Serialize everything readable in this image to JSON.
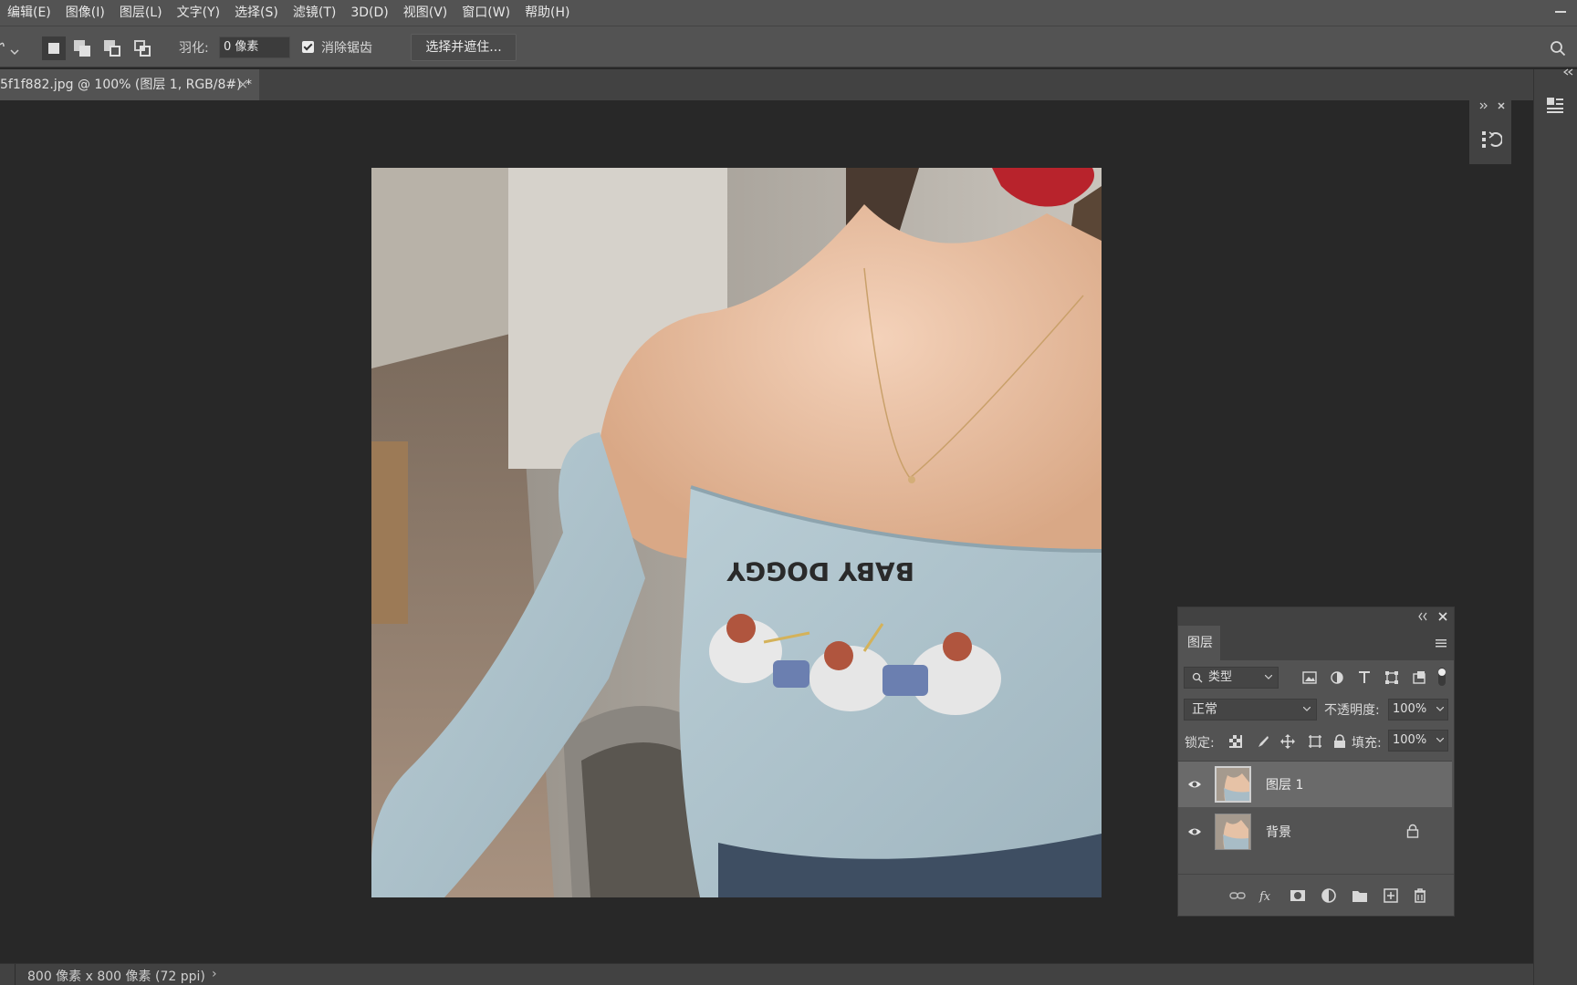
{
  "menu": [
    "编辑(E)",
    "图像(I)",
    "图层(L)",
    "文字(Y)",
    "选择(S)",
    "滤镜(T)",
    "3D(D)",
    "视图(V)",
    "窗口(W)",
    "帮助(H)"
  ],
  "options": {
    "feather_label": "羽化:",
    "feather_value": "0 像素",
    "antialias_label": "消除锯齿",
    "antialias_checked": true,
    "select_mask_label": "选择并遮住..."
  },
  "document": {
    "tab_title": "5f1f882.jpg @ 100% (图层 1, RGB/8#) *",
    "tab_close": "×",
    "image_text": "BABY DOGGY"
  },
  "layers_panel": {
    "title": "图层",
    "kind_filter": "类型",
    "blend_mode": "正常",
    "opacity_label": "不透明度:",
    "opacity_value": "100%",
    "lock_label": "锁定:",
    "fill_label": "填充:",
    "fill_value": "100%",
    "layers": [
      {
        "name": "图层 1",
        "visible": true,
        "selected": true,
        "locked": false
      },
      {
        "name": "背景",
        "visible": true,
        "selected": false,
        "locked": true
      }
    ]
  },
  "status": {
    "doc_info": "800 像素 x 800 像素 (72 ppi)",
    "arrow": "›"
  },
  "colors": {
    "ui_bg": "#535353",
    "canvas_bg": "#282828",
    "panel_dark": "#424242",
    "selected_layer": "#6a6a6a"
  }
}
